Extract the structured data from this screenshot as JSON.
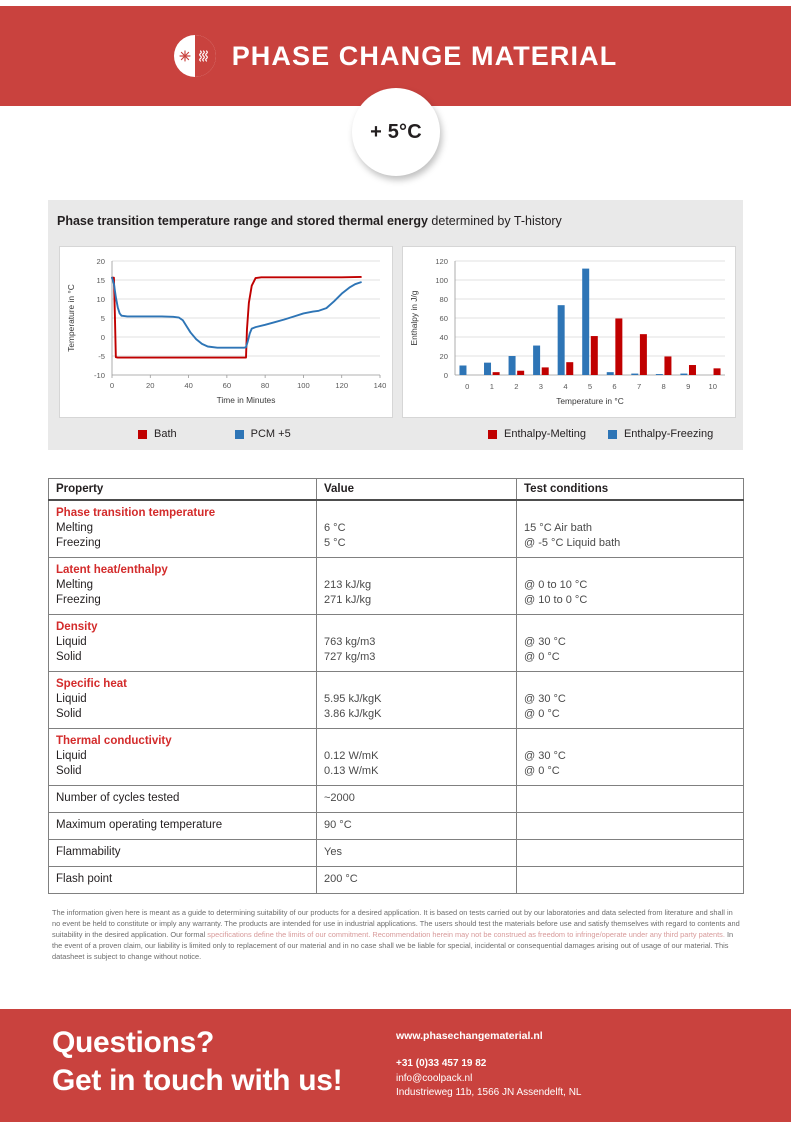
{
  "brand": {
    "title": "PHASE CHANGE MATERIAL",
    "logo_icon": "snowflake-heatwave-circle-icon",
    "accent_red": "#c9423e",
    "heading_red": "#d32b2b"
  },
  "badge": {
    "label": "+ 5°C"
  },
  "chart_panel": {
    "title_bold": "Phase transition temperature range and stored thermal energy",
    "title_light": " determined by T-history"
  },
  "chart_data": [
    {
      "id": "t-history-line-chart",
      "type": "line",
      "title": "",
      "xlabel": "Time in Minutes",
      "ylabel": "Temperature in °C",
      "xlim": [
        0,
        140
      ],
      "ylim": [
        -10,
        20
      ],
      "xticks": [
        0,
        20,
        40,
        60,
        80,
        100,
        120,
        140
      ],
      "yticks": [
        -10,
        -5,
        0,
        5,
        10,
        15,
        20
      ],
      "grid": true,
      "legend_position": "below",
      "series": [
        {
          "name": "Bath",
          "color": "#c00000",
          "points": [
            [
              0,
              15.6
            ],
            [
              1,
              15.6
            ],
            [
              1.5,
              6.0
            ],
            [
              2,
              -5.3
            ],
            [
              3,
              -5.4
            ],
            [
              10,
              -5.4
            ],
            [
              20,
              -5.4
            ],
            [
              30,
              -5.4
            ],
            [
              40,
              -5.4
            ],
            [
              50,
              -5.4
            ],
            [
              60,
              -5.4
            ],
            [
              69,
              -5.4
            ],
            [
              70,
              -5.4
            ],
            [
              70.5,
              2.0
            ],
            [
              71.5,
              9.0
            ],
            [
              73,
              13.5
            ],
            [
              75,
              15.5
            ],
            [
              78,
              15.7
            ],
            [
              90,
              15.7
            ],
            [
              100,
              15.7
            ],
            [
              110,
              15.7
            ],
            [
              120,
              15.7
            ],
            [
              130,
              15.8
            ]
          ]
        },
        {
          "name": "PCM +5",
          "color": "#2e75b6",
          "points": [
            [
              0,
              15.6
            ],
            [
              1,
              14.0
            ],
            [
              2,
              10.5
            ],
            [
              3,
              7.8
            ],
            [
              4,
              6.2
            ],
            [
              5,
              5.6
            ],
            [
              8,
              5.4
            ],
            [
              14,
              5.4
            ],
            [
              20,
              5.4
            ],
            [
              26,
              5.4
            ],
            [
              32,
              5.3
            ],
            [
              35,
              5.1
            ],
            [
              37,
              4.4
            ],
            [
              39,
              2.8
            ],
            [
              41,
              1.2
            ],
            [
              44,
              -0.6
            ],
            [
              47,
              -1.8
            ],
            [
              50,
              -2.5
            ],
            [
              55,
              -2.8
            ],
            [
              60,
              -2.8
            ],
            [
              65,
              -2.8
            ],
            [
              69,
              -2.8
            ],
            [
              70,
              -2.7
            ],
            [
              71,
              -1.0
            ],
            [
              72,
              1.0
            ],
            [
              73,
              2.2
            ],
            [
              75,
              2.6
            ],
            [
              80,
              3.2
            ],
            [
              85,
              3.9
            ],
            [
              90,
              4.6
            ],
            [
              95,
              5.4
            ],
            [
              100,
              6.2
            ],
            [
              105,
              6.7
            ],
            [
              108,
              6.9
            ],
            [
              112,
              7.6
            ],
            [
              116,
              9.4
            ],
            [
              120,
              11.4
            ],
            [
              124,
              13.0
            ],
            [
              127,
              13.9
            ],
            [
              130,
              14.4
            ]
          ]
        }
      ],
      "legend": [
        {
          "label": "Bath",
          "color": "#c00000"
        },
        {
          "label": "PCM +5",
          "color": "#2e75b6"
        }
      ]
    },
    {
      "id": "enthalpy-bar-chart",
      "type": "bar",
      "title": "",
      "xlabel": "Temperature in °C",
      "ylabel": "Enthalpy in J/g",
      "ylim": [
        0,
        120
      ],
      "yticks": [
        0,
        20,
        40,
        60,
        80,
        100,
        120
      ],
      "grid": true,
      "legend_position": "below",
      "categories": [
        "0",
        "1",
        "2",
        "3",
        "4",
        "5",
        "6",
        "7",
        "8",
        "9",
        "10"
      ],
      "series": [
        {
          "name": "Enthalpy-Freezing",
          "color": "#2e75b6",
          "values": [
            10,
            13,
            20,
            31,
            73.5,
            112,
            3,
            1.5,
            1,
            1.5,
            0
          ]
        },
        {
          "name": "Enthalpy-Melting",
          "color": "#c00000",
          "values": [
            0,
            3,
            4.5,
            8,
            13.5,
            41,
            59.5,
            43,
            19.5,
            10.5,
            7
          ]
        }
      ],
      "legend": [
        {
          "label": "Enthalpy-Melting",
          "color": "#c00000"
        },
        {
          "label": "Enthalpy-Freezing",
          "color": "#2e75b6"
        }
      ]
    }
  ],
  "table": {
    "headers": [
      "Property",
      "Value",
      "Test conditions"
    ],
    "rows": [
      {
        "group": "Phase transition temperature",
        "subs": [
          "Melting",
          "Freezing"
        ],
        "values": [
          "6 °C",
          "5 °C"
        ],
        "conditions": [
          "15 °C Air bath",
          "@ -5 °C Liquid bath"
        ]
      },
      {
        "group": "Latent heat/enthalpy",
        "subs": [
          "Melting",
          "Freezing"
        ],
        "values": [
          "213 kJ/kg",
          "271 kJ/kg"
        ],
        "conditions": [
          "@ 0 to 10 °C",
          "@ 10 to 0 °C"
        ]
      },
      {
        "group": "Density",
        "subs": [
          "Liquid",
          "Solid"
        ],
        "values": [
          "763 kg/m3",
          "727 kg/m3"
        ],
        "conditions": [
          "@ 30 °C",
          "@ 0 °C"
        ]
      },
      {
        "group": "Specific heat",
        "subs": [
          "Liquid",
          "Solid"
        ],
        "values": [
          "5.95 kJ/kgK",
          "3.86 kJ/kgK"
        ],
        "conditions": [
          "@ 30 °C",
          "@ 0 °C"
        ]
      },
      {
        "group": "Thermal conductivity",
        "subs": [
          "Liquid",
          "Solid"
        ],
        "values": [
          "0.12 W/mK",
          "0.13 W/mK"
        ],
        "conditions": [
          "@ 30 °C",
          "@ 0 °C"
        ]
      }
    ],
    "simple_rows": [
      {
        "property": "Number of cycles tested",
        "value": "~2000",
        "condition": ""
      },
      {
        "property": "Maximum operating temperature",
        "value": "90 °C",
        "condition": ""
      },
      {
        "property": "Flammability",
        "value": "Yes",
        "condition": ""
      },
      {
        "property": "Flash point",
        "value": "200 °C",
        "condition": ""
      }
    ]
  },
  "disclaimer": {
    "line1": "The information given here is meant as a guide to determining suitability of our products for a desired application. It is based on tests carried out by our",
    "line2": "laboratories and data selected from literature and shall in no event be held to constitute or imply any warranty. The products are intended for use in industrial",
    "line3": "applications. The users should test the materials before use and satisfy themselves with regard to contents and suitability in the desired application. Our formal",
    "line4": "specifications define the limits of our commitment. Recommendation herein may not be construed as freedom to infringe/operate under any third party patents.",
    "line5": "In the event of a proven claim, our liability is limited only to replacement of our material and in no case shall we be liable for special, incidental or consequential",
    "line6": "damages arising out of usage of our material. This datasheet is subject to change without notice."
  },
  "footer": {
    "headline_line1": "Questions?",
    "headline_line2": "Get in touch with us!",
    "website": "www.phasechangematerial.nl",
    "phone": "+31 (0)33 457 19 82",
    "email": "info@coolpack.nl",
    "address": "Industrieweg 11b, 1566 JN Assendelft, NL"
  }
}
